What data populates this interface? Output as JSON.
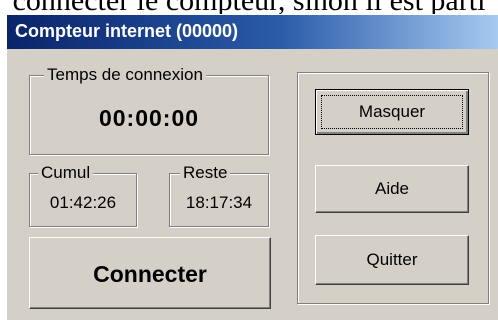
{
  "background_text": "connecter le compteur, sinon il est parti",
  "window": {
    "title": "Compteur internet (00000)"
  },
  "connection": {
    "label": "Temps de connexion",
    "value": "00:00:00"
  },
  "cumul": {
    "label": "Cumul",
    "value": "01:42:26"
  },
  "reste": {
    "label": "Reste",
    "value": "18:17:34"
  },
  "buttons": {
    "connect": "Connecter",
    "hide": "Masquer",
    "help": "Aide",
    "quit": "Quitter"
  },
  "colors": {
    "titlebar_start": "#0a246a",
    "titlebar_end": "#a6caf0",
    "window_face": "#d4d0c8"
  }
}
